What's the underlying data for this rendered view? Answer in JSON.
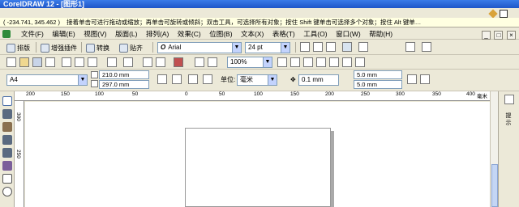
{
  "window": {
    "title": "CorelDRAW 12 - [图形1]"
  },
  "status": {
    "coords": "( -234.741, 345.462 )",
    "hint": "接着单击可进行拖动或缩放；再单击可旋转或倾斜；双击工具，可选择所有对象；按住 Shift 键单击可选择多个对象；按住 Alt 键单…"
  },
  "menu": {
    "items": [
      "文件(F)",
      "编辑(E)",
      "视图(V)",
      "版面(L)",
      "排列(A)",
      "效果(C)",
      "位图(B)",
      "文本(X)",
      "表格(T)",
      "工具(O)",
      "窗口(W)",
      "帮助(H)"
    ],
    "window_controls": [
      "_",
      "□",
      "×"
    ]
  },
  "toolbar1": {
    "layout_label": "排版",
    "plugin_label": "增强插件",
    "convert_label": "转换",
    "paste_label": "贴齐",
    "font_name": "Arial",
    "font_size": "24 pt"
  },
  "toolbar2": {
    "zoom": "100%"
  },
  "propertybar": {
    "paper": "A4",
    "width": "210.0 mm",
    "height": "297.0 mm",
    "unit_label": "单位:",
    "unit": "毫米",
    "nudge": "0.1 mm",
    "dup_x": "5.0 mm",
    "dup_y": "5.0 mm"
  },
  "ruler": {
    "h_labels": [
      "200",
      "150",
      "100",
      "50",
      "0",
      "50",
      "100",
      "150",
      "200",
      "250",
      "300",
      "350",
      "400",
      "毫米"
    ],
    "v_labels": [
      "300",
      "250"
    ]
  },
  "docker": {
    "tab_label": "提示"
  }
}
